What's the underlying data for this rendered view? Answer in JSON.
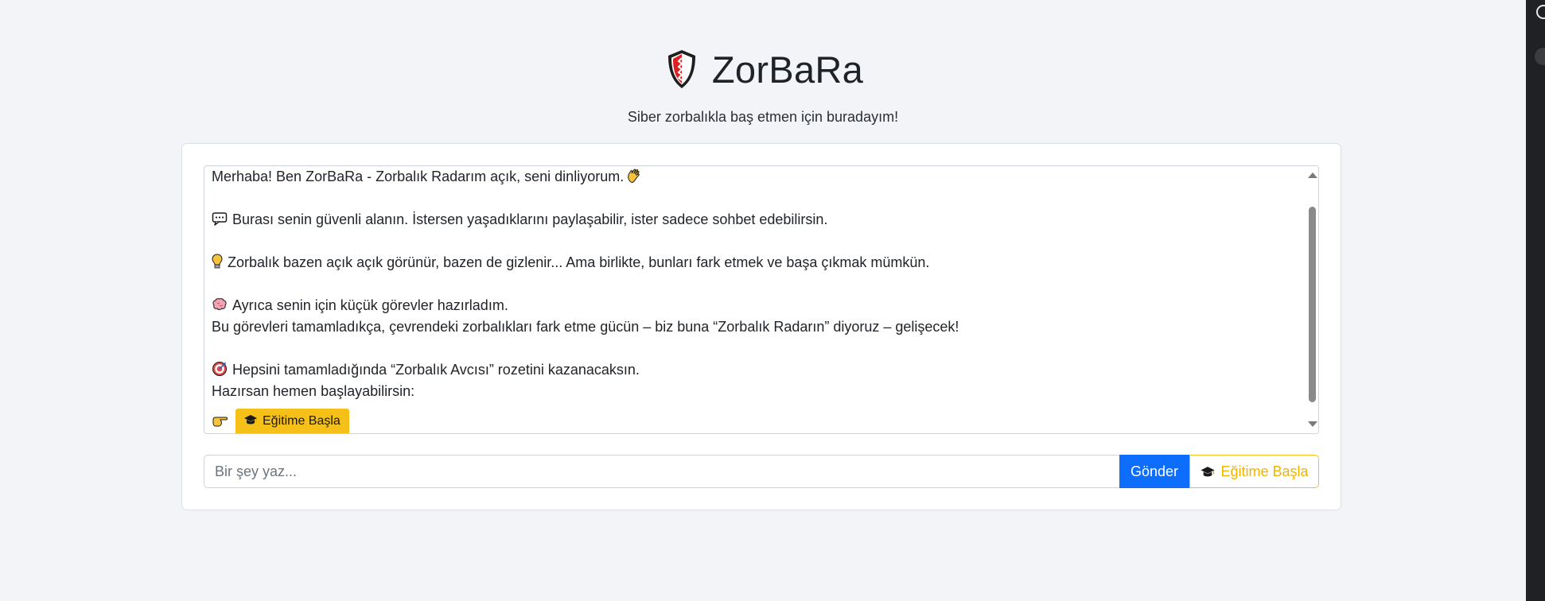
{
  "app": {
    "title": "ZorBaRa",
    "subtitle": "Siber zorbalıkla baş etmen için buradayım!"
  },
  "chat": {
    "messages": [
      {
        "icon": "",
        "text": "Merhaba! Ben ZorBaRa - Zorbalık Radarım açık, seni dinliyorum."
      },
      {
        "icon": "speech-bubble-icon",
        "text": "Burası senin güvenli alanın. İstersen yaşadıklarını paylaşabilir, ister sadece sohbet edebilirsin."
      },
      {
        "icon": "lightbulb-icon",
        "text": "Zorbalık bazen açık açık görünür, bazen de gizlenir... Ama birlikte, bunları fark etmek ve başa çıkmak mümkün."
      },
      {
        "icon": "brain-icon",
        "text": "Ayrıca senin için küçük görevler hazırladım."
      },
      {
        "icon": "",
        "text": "Bu görevleri tamamladıkça, çevrendeki zorbalıkları fark etme gücün – biz buna “Zorbalık Radarın” diyoruz – gelişecek!"
      },
      {
        "icon": "target-icon",
        "text": "Hepsini tamamladığında “Zorbalık Avcısı” rozetini kazanacaksın."
      },
      {
        "icon": "",
        "text": "Hazırsan hemen başlayabilirsin:"
      }
    ],
    "inline_button_label": "Eğitime Başla"
  },
  "input": {
    "placeholder": "Bir şey yaz...",
    "value": ""
  },
  "buttons": {
    "send_label": "Gönder",
    "train_label": "Eğitime Başla"
  },
  "colors": {
    "primary": "#0d6efd",
    "warning": "#f5c018",
    "background": "#f3f4f7"
  }
}
